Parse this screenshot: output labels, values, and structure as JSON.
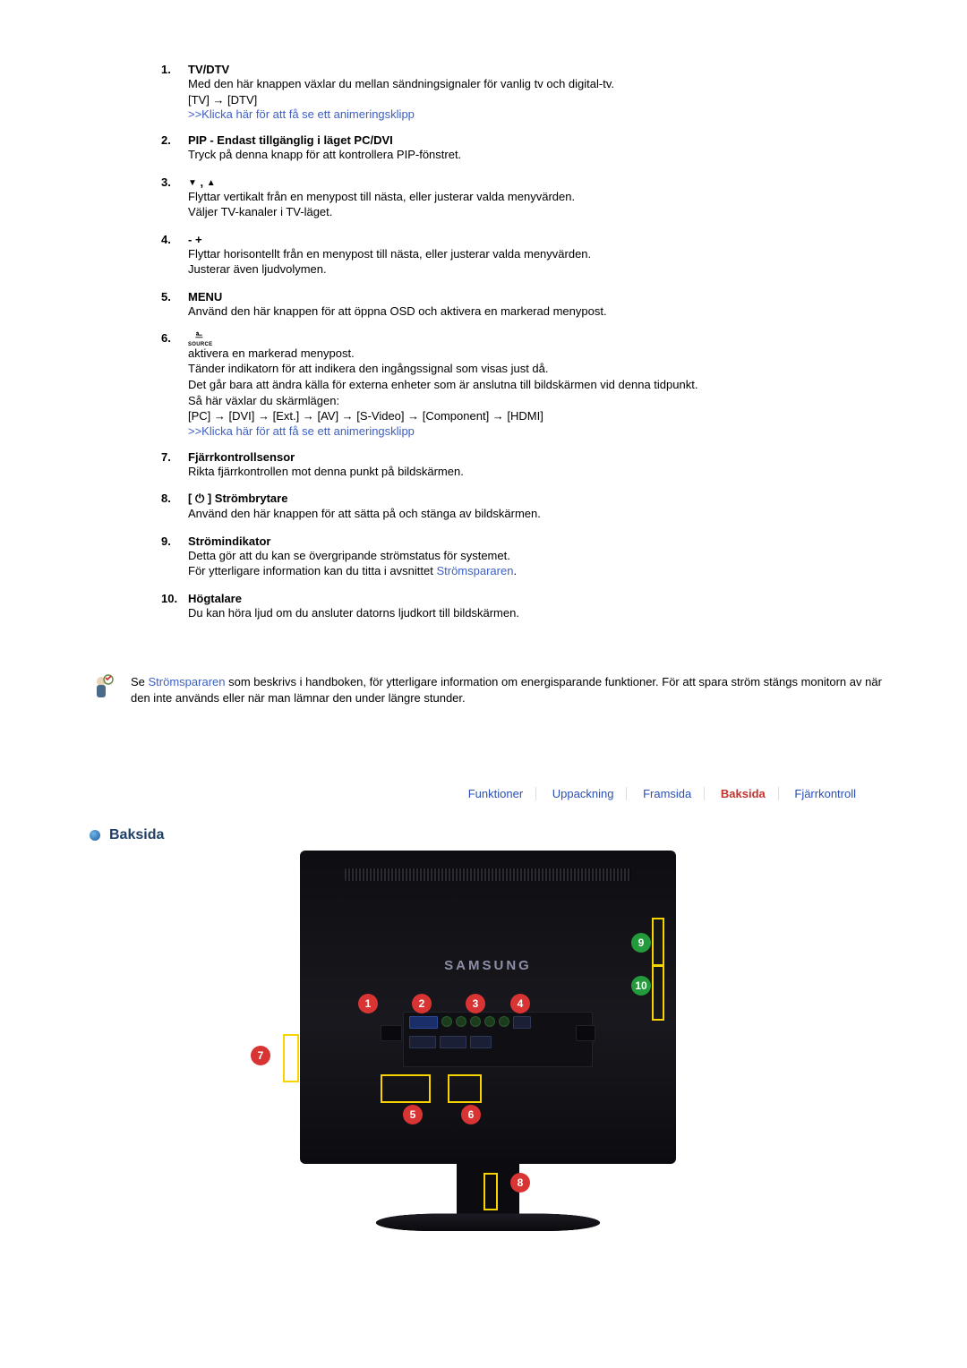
{
  "items": [
    {
      "num": "1.",
      "heading": "TV/DTV",
      "desc1": "Med den här knappen växlar du mellan sändningsignaler för vanlig tv och digital-tv.",
      "desc2": "[TV] → [DTV]",
      "link": ">>Klicka här för att få se ett animeringsklipp"
    },
    {
      "num": "2.",
      "heading": "PIP - Endast tillgänglig i läget PC/DVI",
      "desc1": "Tryck på denna knapp för att kontrollera PIP-fönstret."
    },
    {
      "num": "3.",
      "heading_triangles": true,
      "desc1": "Flyttar vertikalt från en menypost till nästa, eller justerar valda menyvärden.",
      "desc2": "Väljer TV-kanaler i TV-läget."
    },
    {
      "num": "4.",
      "heading": "- +",
      "desc1": "Flyttar horisontellt från en menypost till nästa, eller justerar valda menyvärden.",
      "desc2": "Justerar även ljudvolymen."
    },
    {
      "num": "5.",
      "heading": "MENU",
      "desc1": "Använd den här knappen för att öppna OSD och aktivera en markerad menypost."
    },
    {
      "num": "6.",
      "heading_source": true,
      "lines": [
        "aktivera en markerad menypost.",
        "Tänder indikatorn för att indikera den ingångssignal som visas just då.",
        "Det går bara att ändra källa för externa enheter som är anslutna till bildskärmen vid denna tidpunkt.",
        "Så här växlar du skärmlägen:",
        "[PC] → [DVI] → [Ext.] → [AV] → [S-Video] → [Component] → [HDMI]"
      ],
      "link": ">>Klicka här för att få se ett animeringsklipp"
    },
    {
      "num": "7.",
      "heading": "Fjärrkontrollsensor",
      "desc1": "Rikta fjärrkontrollen mot denna punkt på bildskärmen."
    },
    {
      "num": "8.",
      "heading_pre": "[ ",
      "heading_power": true,
      "heading_post": " ] Strömbrytare",
      "desc1": "Använd den här knappen för att sätta på och stänga av bildskärmen."
    },
    {
      "num": "9.",
      "heading": "Strömindikator",
      "desc1": "Detta gör att du kan se övergripande strömstatus för systemet.",
      "desc2_pre": "För ytterligare information kan du titta i avsnittet ",
      "desc2_link": "Strömspararen",
      "desc2_post": "."
    },
    {
      "num": "10.",
      "heading": "Högtalare",
      "desc1": "Du kan höra ljud om du ansluter datorns ljudkort till bildskärmen."
    }
  ],
  "note_pre": "Se ",
  "note_link": "Strömspararen",
  "note_post": " som beskrivs i handboken, för ytterligare information om energisparande funktioner. För att spara ström stängs monitorn av när den inte används eller när man lämnar den under längre stunder.",
  "tabs": [
    {
      "label": "Funktioner",
      "active": false
    },
    {
      "label": "Uppackning",
      "active": false
    },
    {
      "label": "Framsida",
      "active": false
    },
    {
      "label": "Baksida",
      "active": true
    },
    {
      "label": "Fjärrkontroll",
      "active": false
    }
  ],
  "section_title": "Baksida",
  "logo": "SAMSUNG",
  "callouts": {
    "c1": "1",
    "c2": "2",
    "c3": "3",
    "c4": "4",
    "c5": "5",
    "c6": "6",
    "c7": "7",
    "c8": "8",
    "c9": "9",
    "c10": "10"
  }
}
